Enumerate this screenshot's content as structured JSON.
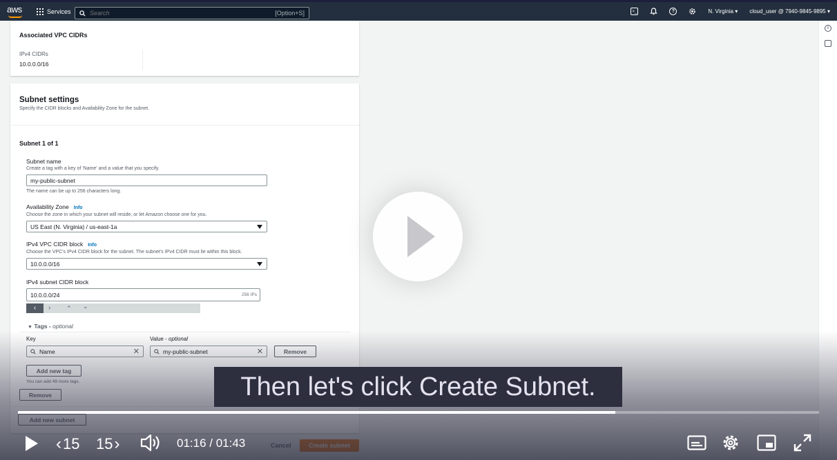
{
  "nav": {
    "logo": "aws",
    "services": "Services",
    "search_placeholder": "Search",
    "search_hint": "[Option+S]",
    "region": "N. Virginia ▾",
    "account": "cloud_user @ 7940-9845-9895 ▾"
  },
  "vpc_panel": {
    "title": "Associated VPC CIDRs",
    "ipv4_label": "IPv4 CIDRs",
    "ipv4_value": "10.0.0.0/16"
  },
  "subnet_settings": {
    "title": "Subnet settings",
    "description": "Specify the CIDR blocks and Availability Zone for the subnet.",
    "subnet_heading": "Subnet 1 of 1",
    "name_label": "Subnet name",
    "name_desc": "Create a tag with a key of 'Name' and a value that you specify.",
    "name_value": "my-public-subnet",
    "name_hint": "The name can be up to 256 characters long.",
    "az_label": "Availability Zone",
    "info": "Info",
    "az_desc": "Choose the zone in which your subnet will reside, or let Amazon choose one for you.",
    "az_value": "US East (N. Virginia) / us-east-1a",
    "vpc_cidr_label": "IPv4 VPC CIDR block",
    "vpc_cidr_desc": "Choose the VPC's IPv4 CIDR block for the subnet. The subnet's IPv4 CIDR must lie within this block.",
    "vpc_cidr_value": "10.0.0.0/16",
    "subnet_cidr_label": "IPv4 subnet CIDR block",
    "subnet_cidr_value": "10.0.0.0/24",
    "subnet_cidr_ips": "256 IPs",
    "tags_label": "Tags -",
    "tags_optional": "optional",
    "key_label": "Key",
    "value_label": "Value -",
    "value_optional": "optional",
    "key_value": "Name",
    "value_value": "my-public-subnet",
    "remove_tag": "Remove",
    "add_tag": "Add new tag",
    "tags_hint": "You can add 49 more tags.",
    "remove_subnet": "Remove",
    "add_subnet": "Add new subnet"
  },
  "footer": {
    "cancel": "Cancel",
    "create": "Create subnet"
  },
  "player": {
    "caption": "Then let's click Create Subnet.",
    "rewind": "15",
    "forward": "15",
    "time": "01:16 / 01:43",
    "progress": 0.746
  }
}
